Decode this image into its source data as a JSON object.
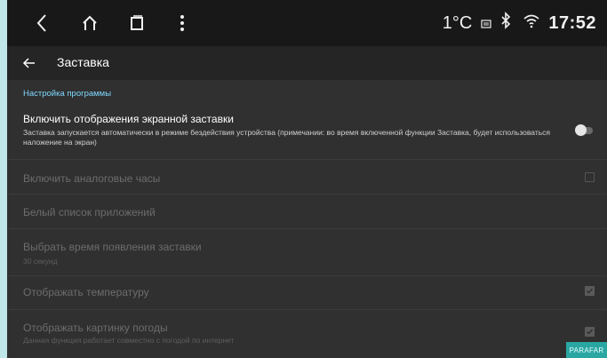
{
  "statusbar": {
    "temperature": "1°C",
    "time": "17:52"
  },
  "appbar": {
    "title": "Заставка"
  },
  "section_header": "Настройка программы",
  "rows": [
    {
      "title": "Включить отображения экранной заставки",
      "subtitle": "Заставка запускается автоматически в режиме бездействия устройства (примечании: во время включенной функции Заставка, будет использоваться наложение на экран)",
      "control": "toggle",
      "on": false,
      "enabled": true
    },
    {
      "title": "Включить аналоговые часы",
      "control": "checkbox",
      "checked": false,
      "enabled": false
    },
    {
      "title": "Белый список приложений",
      "control": "none",
      "enabled": false
    },
    {
      "title": "Выбрать время появления заставки",
      "subtitle": "30 секунд",
      "control": "none",
      "enabled": false
    },
    {
      "title": "Отображать температуру",
      "control": "checkbox",
      "checked": true,
      "enabled": false
    },
    {
      "title": "Отображать картинку погоды",
      "subtitle": "Данная функция работает совместно с погодой по интернет",
      "control": "checkbox",
      "checked": true,
      "enabled": false
    }
  ],
  "watermark": "PARAFAR",
  "colors": {
    "accent": "#7fd9ff",
    "background": "#303030",
    "statusbar": "#181818"
  }
}
